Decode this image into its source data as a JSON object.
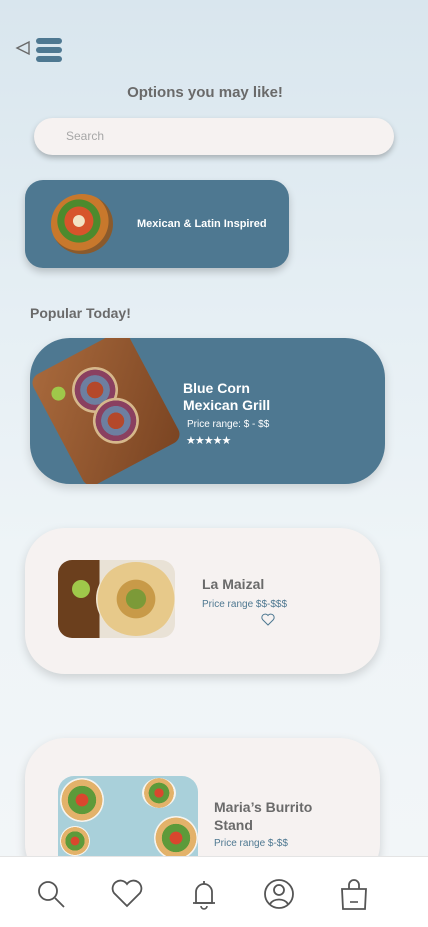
{
  "header": {
    "back_icon": "back-triangle-icon",
    "menu_icon": "hamburger-menu-icon",
    "title": "Options you may like!"
  },
  "search": {
    "placeholder": "Search",
    "value": ""
  },
  "categories": [
    {
      "label": "Mexican & Latin Inspired",
      "image": "nachos-bowl-image"
    }
  ],
  "popular": {
    "title": "Popular Today!",
    "restaurants": [
      {
        "name": "Blue Corn Mexican Grill",
        "price": "Price range: $ - $$",
        "rating": 5,
        "stars": "★★★★★",
        "image": "tacos-board-image"
      },
      {
        "name": "La Maizal",
        "price": "Price range $$-$$$",
        "image": "taco-avocado-image",
        "favorite_icon": "heart-icon"
      },
      {
        "name": "Maria’s Burrito Stand",
        "price": "Price range $-$$",
        "image": "salad-plates-image"
      }
    ]
  },
  "bottom_nav": [
    {
      "icon": "search-icon"
    },
    {
      "icon": "heart-icon"
    },
    {
      "icon": "bell-icon"
    },
    {
      "icon": "profile-icon"
    },
    {
      "icon": "shopping-bag-icon"
    }
  ],
  "colors": {
    "accent": "#4e7891",
    "card_light": "#f6f2f1",
    "text_gray": "#6a6a6a"
  }
}
